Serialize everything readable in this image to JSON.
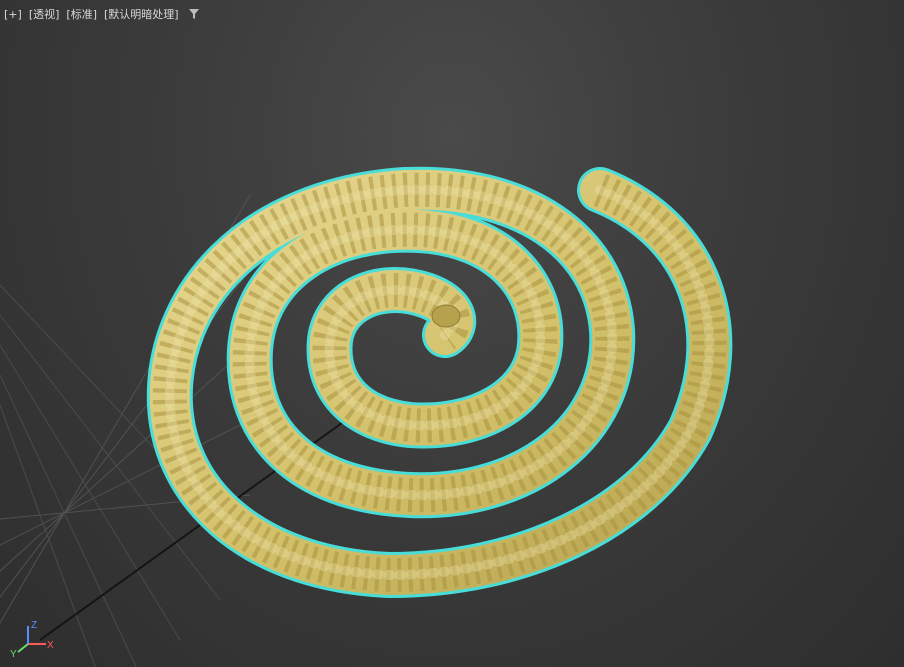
{
  "viewport": {
    "labels": {
      "plus": "[+]",
      "view": "[透视]",
      "shading_standard": "[标准]",
      "shading_default": "[默认明暗处理]"
    },
    "filter_icon": "filter-icon",
    "scene_object": {
      "name": "spiral-rope",
      "color": "#D2C06A",
      "selection_outline": "#49E6E1"
    },
    "axis": {
      "x_label": "X",
      "y_label": "Y",
      "z_label": "Z",
      "x_color": "#ff5a5a",
      "y_color": "#6bdc6b",
      "z_color": "#5a8cff"
    }
  }
}
